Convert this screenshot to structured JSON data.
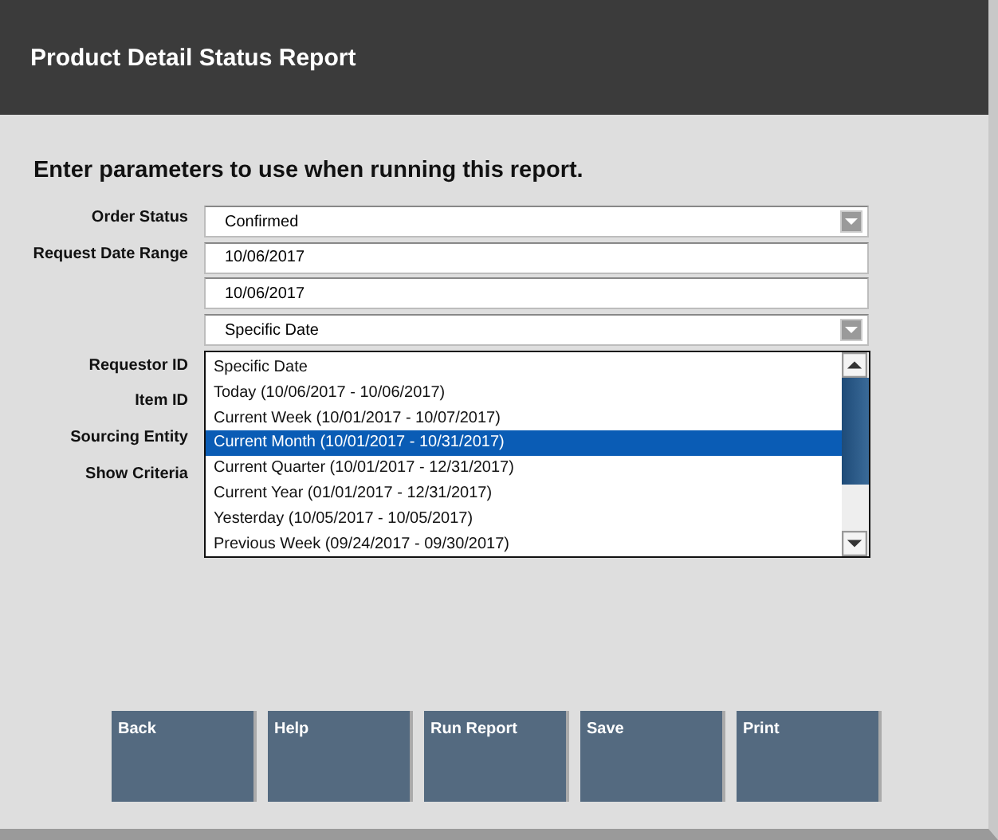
{
  "header": {
    "title": "Product Detail Status Report"
  },
  "instructions": "Enter parameters to use when running this report.",
  "fields": [
    {
      "label": "Order Status",
      "kind": "select",
      "value": "Confirmed"
    },
    {
      "label": "Request Date Range",
      "kind": "text",
      "value": "10/06/2017"
    },
    {
      "kind": "text",
      "value": "10/06/2017"
    },
    {
      "kind": "select",
      "value": "Specific Date"
    }
  ],
  "dropdown_options": [
    {
      "label": "Specific Date",
      "selected": false
    },
    {
      "label": "Today (10/06/2017 - 10/06/2017)",
      "selected": false
    },
    {
      "label": "Current Week (10/01/2017 - 10/07/2017)",
      "selected": false
    },
    {
      "label": "Current Month (10/01/2017 - 10/31/2017)",
      "selected": true
    },
    {
      "label": "Current Quarter (10/01/2017 - 12/31/2017)",
      "selected": false
    },
    {
      "label": "Current Year (01/01/2017 - 12/31/2017)",
      "selected": false
    },
    {
      "label": "Yesterday (10/05/2017 - 10/05/2017)",
      "selected": false
    },
    {
      "label": "Previous Week (09/24/2017 - 09/30/2017)",
      "selected": false
    }
  ],
  "hidden_field_labels": [
    "Requestor ID",
    "Item ID",
    "Sourcing Entity",
    "Show Criteria"
  ],
  "buttons": [
    "Back",
    "Help",
    "Run Report",
    "Save",
    "Print"
  ]
}
